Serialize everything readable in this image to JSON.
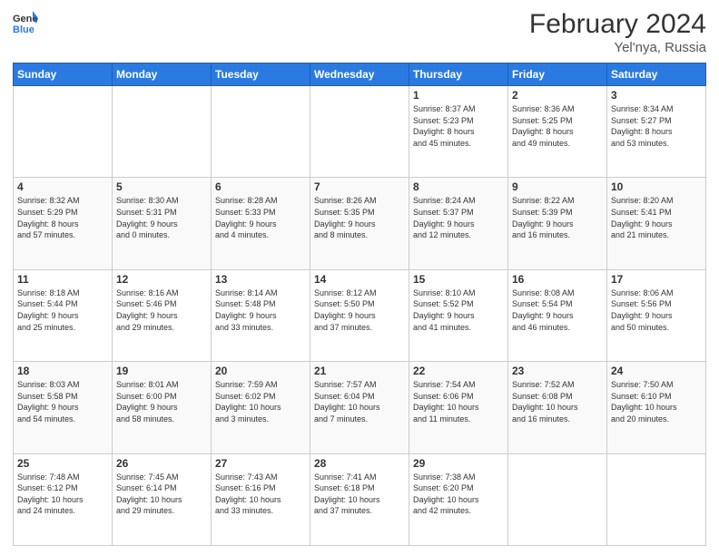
{
  "header": {
    "logo_general": "General",
    "logo_blue": "Blue",
    "month_title": "February 2024",
    "location": "Yel'nya, Russia"
  },
  "weekdays": [
    "Sunday",
    "Monday",
    "Tuesday",
    "Wednesday",
    "Thursday",
    "Friday",
    "Saturday"
  ],
  "weeks": [
    [
      {
        "day": "",
        "info": ""
      },
      {
        "day": "",
        "info": ""
      },
      {
        "day": "",
        "info": ""
      },
      {
        "day": "",
        "info": ""
      },
      {
        "day": "1",
        "info": "Sunrise: 8:37 AM\nSunset: 5:23 PM\nDaylight: 8 hours\nand 45 minutes."
      },
      {
        "day": "2",
        "info": "Sunrise: 8:36 AM\nSunset: 5:25 PM\nDaylight: 8 hours\nand 49 minutes."
      },
      {
        "day": "3",
        "info": "Sunrise: 8:34 AM\nSunset: 5:27 PM\nDaylight: 8 hours\nand 53 minutes."
      }
    ],
    [
      {
        "day": "4",
        "info": "Sunrise: 8:32 AM\nSunset: 5:29 PM\nDaylight: 8 hours\nand 57 minutes."
      },
      {
        "day": "5",
        "info": "Sunrise: 8:30 AM\nSunset: 5:31 PM\nDaylight: 9 hours\nand 0 minutes."
      },
      {
        "day": "6",
        "info": "Sunrise: 8:28 AM\nSunset: 5:33 PM\nDaylight: 9 hours\nand 4 minutes."
      },
      {
        "day": "7",
        "info": "Sunrise: 8:26 AM\nSunset: 5:35 PM\nDaylight: 9 hours\nand 8 minutes."
      },
      {
        "day": "8",
        "info": "Sunrise: 8:24 AM\nSunset: 5:37 PM\nDaylight: 9 hours\nand 12 minutes."
      },
      {
        "day": "9",
        "info": "Sunrise: 8:22 AM\nSunset: 5:39 PM\nDaylight: 9 hours\nand 16 minutes."
      },
      {
        "day": "10",
        "info": "Sunrise: 8:20 AM\nSunset: 5:41 PM\nDaylight: 9 hours\nand 21 minutes."
      }
    ],
    [
      {
        "day": "11",
        "info": "Sunrise: 8:18 AM\nSunset: 5:44 PM\nDaylight: 9 hours\nand 25 minutes."
      },
      {
        "day": "12",
        "info": "Sunrise: 8:16 AM\nSunset: 5:46 PM\nDaylight: 9 hours\nand 29 minutes."
      },
      {
        "day": "13",
        "info": "Sunrise: 8:14 AM\nSunset: 5:48 PM\nDaylight: 9 hours\nand 33 minutes."
      },
      {
        "day": "14",
        "info": "Sunrise: 8:12 AM\nSunset: 5:50 PM\nDaylight: 9 hours\nand 37 minutes."
      },
      {
        "day": "15",
        "info": "Sunrise: 8:10 AM\nSunset: 5:52 PM\nDaylight: 9 hours\nand 41 minutes."
      },
      {
        "day": "16",
        "info": "Sunrise: 8:08 AM\nSunset: 5:54 PM\nDaylight: 9 hours\nand 46 minutes."
      },
      {
        "day": "17",
        "info": "Sunrise: 8:06 AM\nSunset: 5:56 PM\nDaylight: 9 hours\nand 50 minutes."
      }
    ],
    [
      {
        "day": "18",
        "info": "Sunrise: 8:03 AM\nSunset: 5:58 PM\nDaylight: 9 hours\nand 54 minutes."
      },
      {
        "day": "19",
        "info": "Sunrise: 8:01 AM\nSunset: 6:00 PM\nDaylight: 9 hours\nand 58 minutes."
      },
      {
        "day": "20",
        "info": "Sunrise: 7:59 AM\nSunset: 6:02 PM\nDaylight: 10 hours\nand 3 minutes."
      },
      {
        "day": "21",
        "info": "Sunrise: 7:57 AM\nSunset: 6:04 PM\nDaylight: 10 hours\nand 7 minutes."
      },
      {
        "day": "22",
        "info": "Sunrise: 7:54 AM\nSunset: 6:06 PM\nDaylight: 10 hours\nand 11 minutes."
      },
      {
        "day": "23",
        "info": "Sunrise: 7:52 AM\nSunset: 6:08 PM\nDaylight: 10 hours\nand 16 minutes."
      },
      {
        "day": "24",
        "info": "Sunrise: 7:50 AM\nSunset: 6:10 PM\nDaylight: 10 hours\nand 20 minutes."
      }
    ],
    [
      {
        "day": "25",
        "info": "Sunrise: 7:48 AM\nSunset: 6:12 PM\nDaylight: 10 hours\nand 24 minutes."
      },
      {
        "day": "26",
        "info": "Sunrise: 7:45 AM\nSunset: 6:14 PM\nDaylight: 10 hours\nand 29 minutes."
      },
      {
        "day": "27",
        "info": "Sunrise: 7:43 AM\nSunset: 6:16 PM\nDaylight: 10 hours\nand 33 minutes."
      },
      {
        "day": "28",
        "info": "Sunrise: 7:41 AM\nSunset: 6:18 PM\nDaylight: 10 hours\nand 37 minutes."
      },
      {
        "day": "29",
        "info": "Sunrise: 7:38 AM\nSunset: 6:20 PM\nDaylight: 10 hours\nand 42 minutes."
      },
      {
        "day": "",
        "info": ""
      },
      {
        "day": "",
        "info": ""
      }
    ]
  ]
}
